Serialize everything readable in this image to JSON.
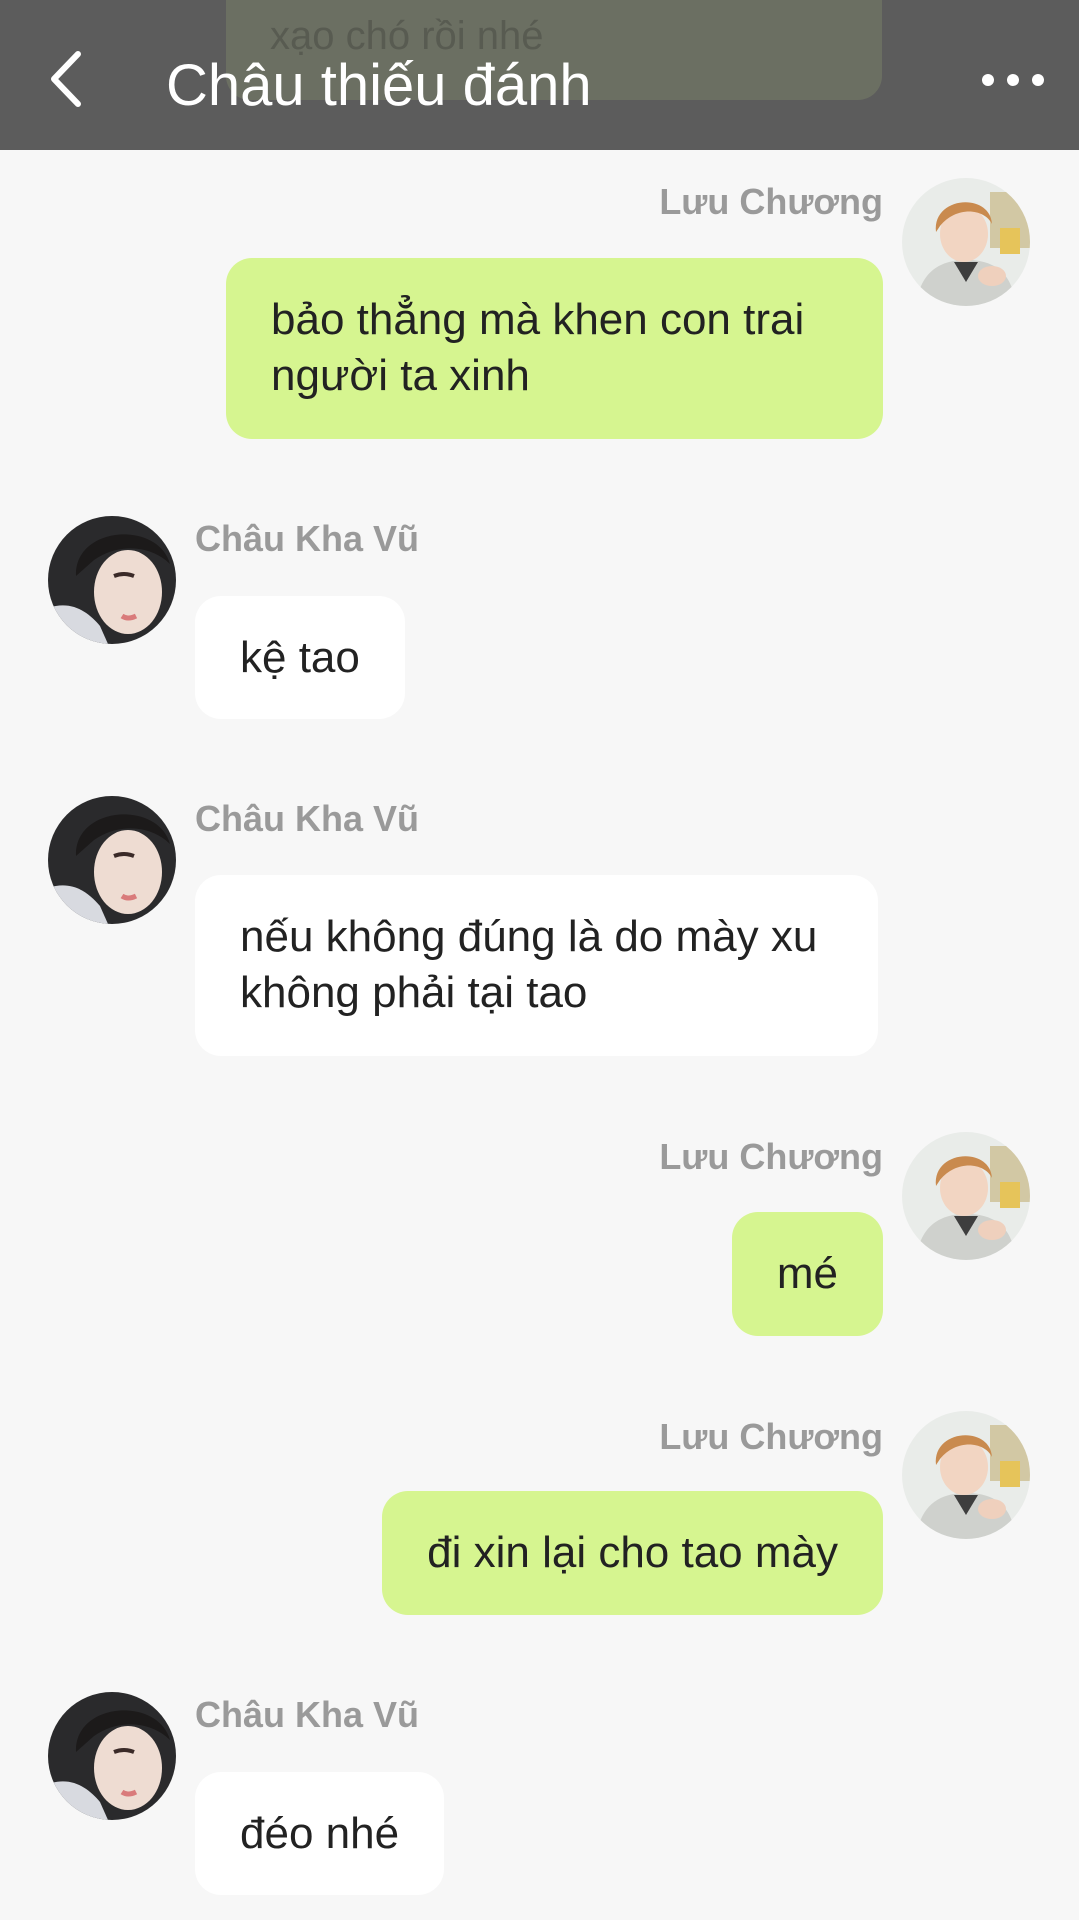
{
  "header": {
    "title": "Châu thiếu đánh",
    "partial_previous_message": "xạo chó rồi nhé",
    "back_icon": "chevron-left-icon",
    "more_icon": "more-horizontal-icon"
  },
  "colors": {
    "header_background": "#5c5c5c",
    "chat_background": "#f7f7f7",
    "outgoing_bubble": "#d6f590",
    "incoming_bubble": "#ffffff",
    "sender_name": "#9a9a9a"
  },
  "messages": [
    {
      "direction": "outgoing",
      "sender": "Lưu Chương",
      "text": "bảo thẳng mà khen con trai người ta xinh"
    },
    {
      "direction": "incoming",
      "sender": "Châu Kha Vũ",
      "text": "kệ tao"
    },
    {
      "direction": "incoming",
      "sender": "Châu Kha Vũ",
      "text": "nếu không đúng là do mày xu không phải tại tao"
    },
    {
      "direction": "outgoing",
      "sender": "Lưu Chương",
      "text": "mé"
    },
    {
      "direction": "outgoing",
      "sender": "Lưu Chương",
      "text": "đi xin lại cho tao mày"
    },
    {
      "direction": "incoming",
      "sender": "Châu Kha Vũ",
      "text": "đéo nhé"
    }
  ]
}
